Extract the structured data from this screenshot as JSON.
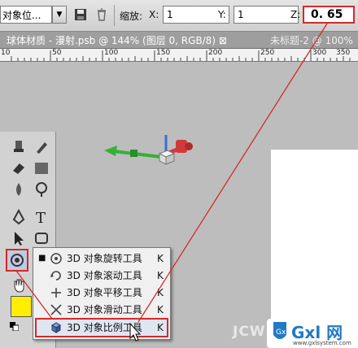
{
  "optionbar": {
    "preset_value": "对象位...",
    "scale_label": "缩放:",
    "x_label": "X:",
    "x_value": "1",
    "y_label": "Y:",
    "y_value": "1",
    "z_label": "Z:",
    "z_value": "0. 65"
  },
  "tabs": [
    {
      "label": "球体材质 - 漫射.psb @ 144% (图层 0, RGB/8) ⊠"
    },
    {
      "label": "未标题-2 @ 100%"
    }
  ],
  "ruler": {
    "ticks": [
      "10",
      "50",
      "100",
      "150",
      "200",
      "250",
      "300",
      "350"
    ]
  },
  "flyout": {
    "items": [
      {
        "label": "3D 对象旋转工具",
        "key": "K",
        "icon": "3d-rotate-icon",
        "active": true
      },
      {
        "label": "3D 对象滚动工具",
        "key": "K",
        "icon": "3d-roll-icon",
        "active": false
      },
      {
        "label": "3D 对象平移工具",
        "key": "K",
        "icon": "3d-pan-icon",
        "active": false
      },
      {
        "label": "3D 对象滑动工具",
        "key": "K",
        "icon": "3d-slide-icon",
        "active": false
      },
      {
        "label": "3D 对象比例工具",
        "key": "K",
        "icon": "3d-scale-icon",
        "active": false
      }
    ]
  },
  "watermark": "JCW",
  "logo": {
    "word": "Gxl 网",
    "url": "www.gxlsystem.com"
  },
  "colors": {
    "highlight": "#d42a2a",
    "foreground": "#ffee00"
  }
}
